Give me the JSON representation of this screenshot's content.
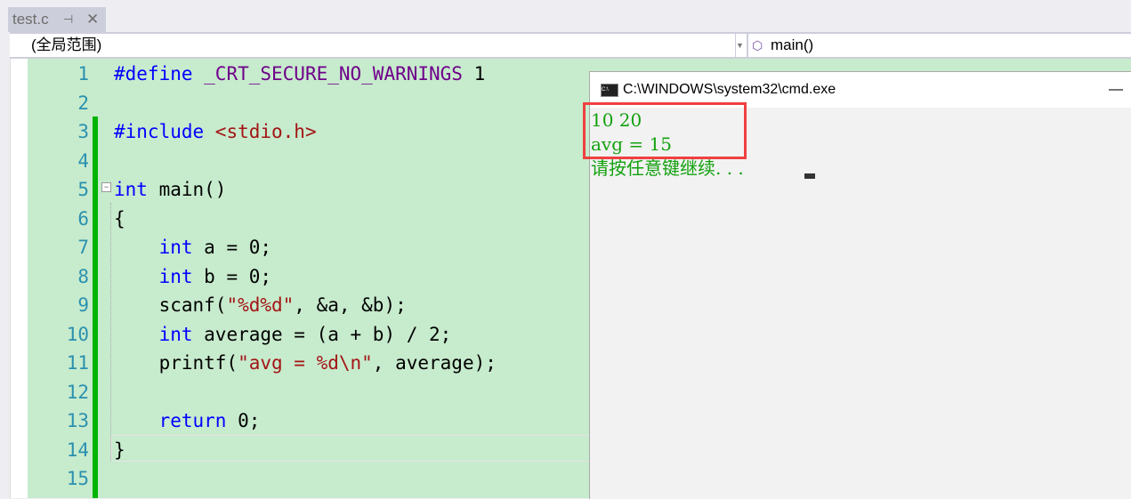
{
  "tab": {
    "title": "test.c",
    "pin_icon": "pin-icon",
    "close_icon": "close-icon"
  },
  "nav": {
    "scope": "(全局范围)",
    "function": "main()"
  },
  "editor": {
    "lines": [
      [
        [
          "#define ",
          "kw"
        ],
        [
          "_CRT_SECURE_NO_WARNINGS",
          "mac"
        ],
        [
          " 1",
          ""
        ]
      ],
      [],
      [
        [
          "#include ",
          "kw"
        ],
        [
          "<stdio.h>",
          "str"
        ]
      ],
      [],
      [
        [
          "int",
          "kw"
        ],
        [
          " main()",
          ""
        ]
      ],
      [
        [
          "{",
          ""
        ]
      ],
      [
        [
          "    ",
          ""
        ],
        [
          "int",
          "kw"
        ],
        [
          " a = 0;",
          ""
        ]
      ],
      [
        [
          "    ",
          ""
        ],
        [
          "int",
          "kw"
        ],
        [
          " b = 0;",
          ""
        ]
      ],
      [
        [
          "    scanf(",
          ""
        ],
        [
          "\"%d%d\"",
          "str"
        ],
        [
          ", &a, &b);",
          ""
        ]
      ],
      [
        [
          "    ",
          ""
        ],
        [
          "int",
          "kw"
        ],
        [
          " average = (a + b) / 2;",
          ""
        ]
      ],
      [
        [
          "    printf(",
          ""
        ],
        [
          "\"avg = %d\\n\"",
          "str"
        ],
        [
          ", average);",
          ""
        ]
      ],
      [],
      [
        [
          "    ",
          ""
        ],
        [
          "return",
          "kw"
        ],
        [
          " 0;",
          ""
        ]
      ],
      [
        [
          "}",
          ""
        ]
      ],
      []
    ]
  },
  "console": {
    "title": "C:\\WINDOWS\\system32\\cmd.exe",
    "minimize": "—",
    "lines": [
      "10 20",
      "avg = 15",
      "请按任意键继续. . ."
    ]
  },
  "colors": {
    "keyword": "#0000ff",
    "macro": "#6f008a",
    "string": "#a31515",
    "console_text": "#13a10e",
    "highlight_box": "#f04040"
  }
}
